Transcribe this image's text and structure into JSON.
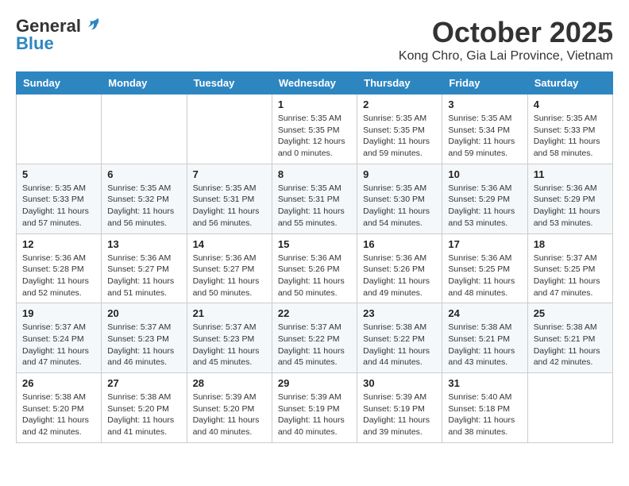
{
  "header": {
    "logo_general": "General",
    "logo_blue": "Blue",
    "month_title": "October 2025",
    "location": "Kong Chro, Gia Lai Province, Vietnam"
  },
  "weekdays": [
    "Sunday",
    "Monday",
    "Tuesday",
    "Wednesday",
    "Thursday",
    "Friday",
    "Saturday"
  ],
  "weeks": [
    [
      {
        "day": "",
        "sunrise": "",
        "sunset": "",
        "daylight": ""
      },
      {
        "day": "",
        "sunrise": "",
        "sunset": "",
        "daylight": ""
      },
      {
        "day": "",
        "sunrise": "",
        "sunset": "",
        "daylight": ""
      },
      {
        "day": "1",
        "sunrise": "Sunrise: 5:35 AM",
        "sunset": "Sunset: 5:35 PM",
        "daylight": "Daylight: 12 hours and 0 minutes."
      },
      {
        "day": "2",
        "sunrise": "Sunrise: 5:35 AM",
        "sunset": "Sunset: 5:35 PM",
        "daylight": "Daylight: 11 hours and 59 minutes."
      },
      {
        "day": "3",
        "sunrise": "Sunrise: 5:35 AM",
        "sunset": "Sunset: 5:34 PM",
        "daylight": "Daylight: 11 hours and 59 minutes."
      },
      {
        "day": "4",
        "sunrise": "Sunrise: 5:35 AM",
        "sunset": "Sunset: 5:33 PM",
        "daylight": "Daylight: 11 hours and 58 minutes."
      }
    ],
    [
      {
        "day": "5",
        "sunrise": "Sunrise: 5:35 AM",
        "sunset": "Sunset: 5:33 PM",
        "daylight": "Daylight: 11 hours and 57 minutes."
      },
      {
        "day": "6",
        "sunrise": "Sunrise: 5:35 AM",
        "sunset": "Sunset: 5:32 PM",
        "daylight": "Daylight: 11 hours and 56 minutes."
      },
      {
        "day": "7",
        "sunrise": "Sunrise: 5:35 AM",
        "sunset": "Sunset: 5:31 PM",
        "daylight": "Daylight: 11 hours and 56 minutes."
      },
      {
        "day": "8",
        "sunrise": "Sunrise: 5:35 AM",
        "sunset": "Sunset: 5:31 PM",
        "daylight": "Daylight: 11 hours and 55 minutes."
      },
      {
        "day": "9",
        "sunrise": "Sunrise: 5:35 AM",
        "sunset": "Sunset: 5:30 PM",
        "daylight": "Daylight: 11 hours and 54 minutes."
      },
      {
        "day": "10",
        "sunrise": "Sunrise: 5:36 AM",
        "sunset": "Sunset: 5:29 PM",
        "daylight": "Daylight: 11 hours and 53 minutes."
      },
      {
        "day": "11",
        "sunrise": "Sunrise: 5:36 AM",
        "sunset": "Sunset: 5:29 PM",
        "daylight": "Daylight: 11 hours and 53 minutes."
      }
    ],
    [
      {
        "day": "12",
        "sunrise": "Sunrise: 5:36 AM",
        "sunset": "Sunset: 5:28 PM",
        "daylight": "Daylight: 11 hours and 52 minutes."
      },
      {
        "day": "13",
        "sunrise": "Sunrise: 5:36 AM",
        "sunset": "Sunset: 5:27 PM",
        "daylight": "Daylight: 11 hours and 51 minutes."
      },
      {
        "day": "14",
        "sunrise": "Sunrise: 5:36 AM",
        "sunset": "Sunset: 5:27 PM",
        "daylight": "Daylight: 11 hours and 50 minutes."
      },
      {
        "day": "15",
        "sunrise": "Sunrise: 5:36 AM",
        "sunset": "Sunset: 5:26 PM",
        "daylight": "Daylight: 11 hours and 50 minutes."
      },
      {
        "day": "16",
        "sunrise": "Sunrise: 5:36 AM",
        "sunset": "Sunset: 5:26 PM",
        "daylight": "Daylight: 11 hours and 49 minutes."
      },
      {
        "day": "17",
        "sunrise": "Sunrise: 5:36 AM",
        "sunset": "Sunset: 5:25 PM",
        "daylight": "Daylight: 11 hours and 48 minutes."
      },
      {
        "day": "18",
        "sunrise": "Sunrise: 5:37 AM",
        "sunset": "Sunset: 5:25 PM",
        "daylight": "Daylight: 11 hours and 47 minutes."
      }
    ],
    [
      {
        "day": "19",
        "sunrise": "Sunrise: 5:37 AM",
        "sunset": "Sunset: 5:24 PM",
        "daylight": "Daylight: 11 hours and 47 minutes."
      },
      {
        "day": "20",
        "sunrise": "Sunrise: 5:37 AM",
        "sunset": "Sunset: 5:23 PM",
        "daylight": "Daylight: 11 hours and 46 minutes."
      },
      {
        "day": "21",
        "sunrise": "Sunrise: 5:37 AM",
        "sunset": "Sunset: 5:23 PM",
        "daylight": "Daylight: 11 hours and 45 minutes."
      },
      {
        "day": "22",
        "sunrise": "Sunrise: 5:37 AM",
        "sunset": "Sunset: 5:22 PM",
        "daylight": "Daylight: 11 hours and 45 minutes."
      },
      {
        "day": "23",
        "sunrise": "Sunrise: 5:38 AM",
        "sunset": "Sunset: 5:22 PM",
        "daylight": "Daylight: 11 hours and 44 minutes."
      },
      {
        "day": "24",
        "sunrise": "Sunrise: 5:38 AM",
        "sunset": "Sunset: 5:21 PM",
        "daylight": "Daylight: 11 hours and 43 minutes."
      },
      {
        "day": "25",
        "sunrise": "Sunrise: 5:38 AM",
        "sunset": "Sunset: 5:21 PM",
        "daylight": "Daylight: 11 hours and 42 minutes."
      }
    ],
    [
      {
        "day": "26",
        "sunrise": "Sunrise: 5:38 AM",
        "sunset": "Sunset: 5:20 PM",
        "daylight": "Daylight: 11 hours and 42 minutes."
      },
      {
        "day": "27",
        "sunrise": "Sunrise: 5:38 AM",
        "sunset": "Sunset: 5:20 PM",
        "daylight": "Daylight: 11 hours and 41 minutes."
      },
      {
        "day": "28",
        "sunrise": "Sunrise: 5:39 AM",
        "sunset": "Sunset: 5:20 PM",
        "daylight": "Daylight: 11 hours and 40 minutes."
      },
      {
        "day": "29",
        "sunrise": "Sunrise: 5:39 AM",
        "sunset": "Sunset: 5:19 PM",
        "daylight": "Daylight: 11 hours and 40 minutes."
      },
      {
        "day": "30",
        "sunrise": "Sunrise: 5:39 AM",
        "sunset": "Sunset: 5:19 PM",
        "daylight": "Daylight: 11 hours and 39 minutes."
      },
      {
        "day": "31",
        "sunrise": "Sunrise: 5:40 AM",
        "sunset": "Sunset: 5:18 PM",
        "daylight": "Daylight: 11 hours and 38 minutes."
      },
      {
        "day": "",
        "sunrise": "",
        "sunset": "",
        "daylight": ""
      }
    ]
  ]
}
